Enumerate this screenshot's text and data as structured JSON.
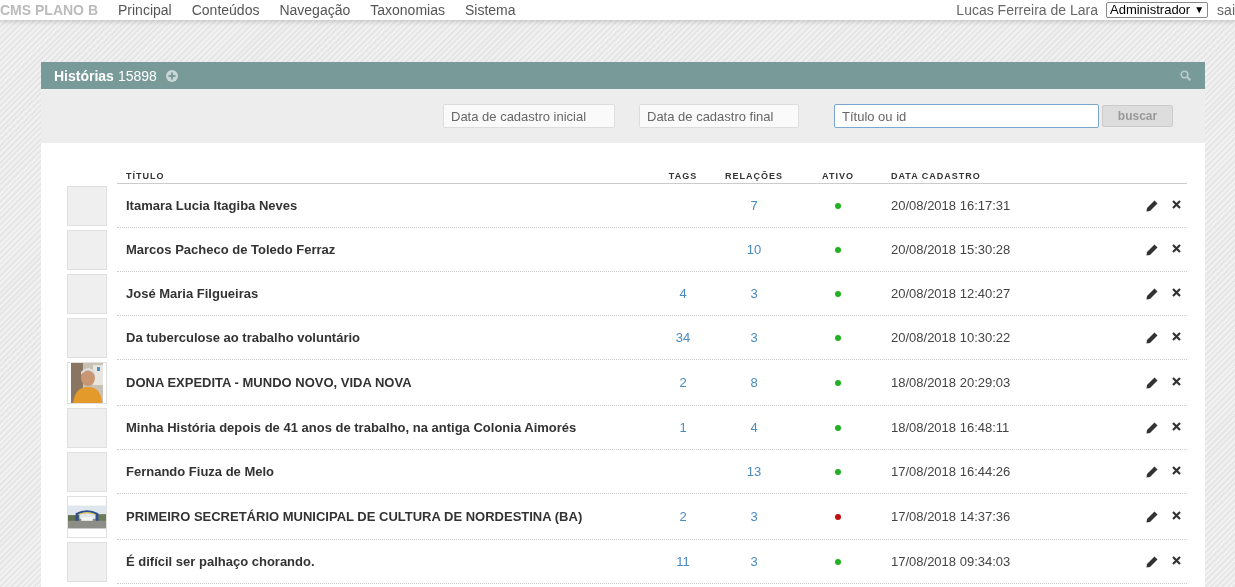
{
  "top_bar": {
    "brand": "CMS PLANO B",
    "menu": [
      {
        "label": "Principal"
      },
      {
        "label": "Conteúdos"
      },
      {
        "label": "Navegação"
      },
      {
        "label": "Taxonomias"
      },
      {
        "label": "Sistema"
      }
    ],
    "user": "Lucas Ferreira de Lara",
    "role": "Administrador",
    "role_caret": "▼",
    "logout": "sai"
  },
  "panel": {
    "title": "Histórias",
    "count": "15898",
    "filters": {
      "start_date": {
        "placeholder": "Data de cadastro inicial"
      },
      "end_date": {
        "placeholder": "Data de cadastro final"
      },
      "search": {
        "placeholder": "Título ou id",
        "focused": true
      },
      "button": "buscar"
    },
    "table": {
      "columns": [
        "TÍTULO",
        "TAGS",
        "RELAÇÕES",
        "ATIVO",
        "DATA CADASTRO"
      ],
      "rows": [
        {
          "thumb": {
            "kind": "placeholder"
          },
          "title": "Itamara Lucia Itagiba Neves",
          "tags": "",
          "relations": "7",
          "active": true,
          "date": "20/08/2018 16:17:31"
        },
        {
          "thumb": {
            "kind": "placeholder"
          },
          "title": "Marcos Pacheco de Toledo Ferraz",
          "tags": "",
          "relations": "10",
          "active": true,
          "date": "20/08/2018 15:30:28"
        },
        {
          "thumb": {
            "kind": "placeholder"
          },
          "title": "José Maria Filgueiras",
          "tags": "4",
          "relations": "3",
          "active": true,
          "date": "20/08/2018 12:40:27"
        },
        {
          "thumb": {
            "kind": "placeholder"
          },
          "title": "Da tuberculose ao trabalho voluntário",
          "tags": "34",
          "relations": "3",
          "active": true,
          "date": "20/08/2018 10:30:22"
        },
        {
          "title": "DONA EXPEDITA - MUNDO NOVO, VIDA NOVA",
          "tags": "2",
          "relations": "8",
          "active": true,
          "date": "18/08/2018 20:29:03"
        },
        {
          "thumb": {
            "kind": "placeholder"
          },
          "title": "Minha História depois de 41 anos de trabalho, na antiga Colonia Aimorés",
          "tags": "1",
          "relations": "4",
          "active": true,
          "date": "18/08/2018 16:48:11"
        },
        {
          "thumb": {
            "kind": "placeholder"
          },
          "title": "Fernando Fiuza de Melo",
          "tags": "",
          "relations": "13",
          "active": true,
          "date": "17/08/2018 16:44:26"
        },
        {
          "title": "PRIMEIRO SECRETÁRIO MUNICIPAL DE CULTURA DE NORDESTINA (BA)",
          "tags": "2",
          "relations": "3",
          "active": false,
          "date": "17/08/2018 14:37:36"
        },
        {
          "thumb": {
            "kind": "placeholder"
          },
          "title": "É difícil ser palhaço chorando.",
          "tags": "11",
          "relations": "3",
          "active": true,
          "date": "17/08/2018 09:34:03"
        }
      ]
    }
  }
}
